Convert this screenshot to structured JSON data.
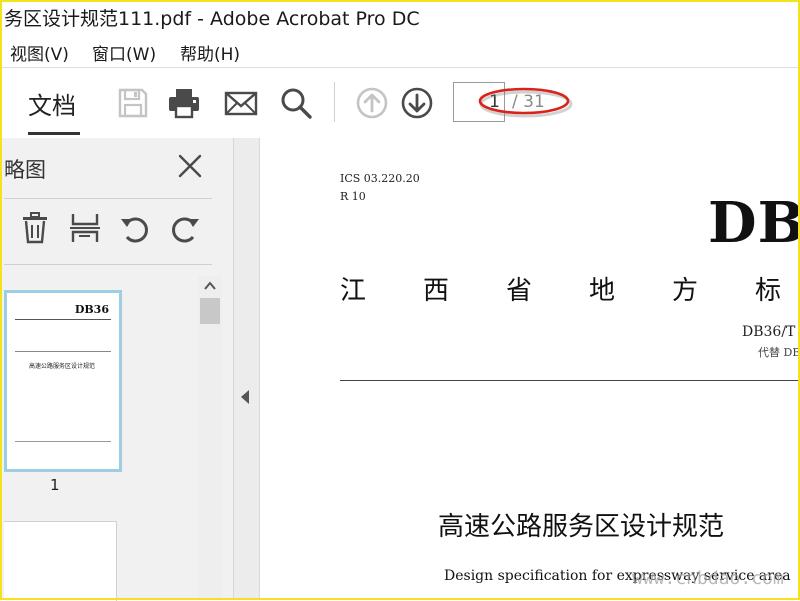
{
  "window": {
    "title": "务区设计规范111.pdf - Adobe Acrobat Pro DC"
  },
  "menubar": {
    "items": [
      "视图(V)",
      "窗口(W)",
      "帮助(H)"
    ]
  },
  "toolbar": {
    "doc_tab": "文档",
    "icons": [
      "save-icon",
      "print-icon",
      "email-icon",
      "search-icon",
      "page-up-icon",
      "page-down-icon"
    ],
    "page_current": "1",
    "page_total": "/ 31",
    "annotation_color": "#d8231a"
  },
  "sidebar": {
    "title": "略图",
    "tools": [
      "delete-icon",
      "extract-icon",
      "undo-icon",
      "redo-icon"
    ],
    "thumbnail": {
      "db": "DB36",
      "title": "高速公路服务区设计规范",
      "label": "1"
    }
  },
  "document": {
    "ics": "ICS 03.220.20",
    "r": "R 10",
    "db": "DB",
    "province": "江西省地方标",
    "std_no": "DB36/T",
    "replaces": "代替 DB",
    "title_cn": "高速公路服务区设计规范",
    "title_en": "Design specification for expressway service area"
  },
  "watermark": {
    "bottom": "www.cnbdao.com"
  },
  "colors": {
    "accent_yellow": "#f4e31a",
    "disabled_icon": "#c4c4c4",
    "icon": "#4a4a4a"
  }
}
